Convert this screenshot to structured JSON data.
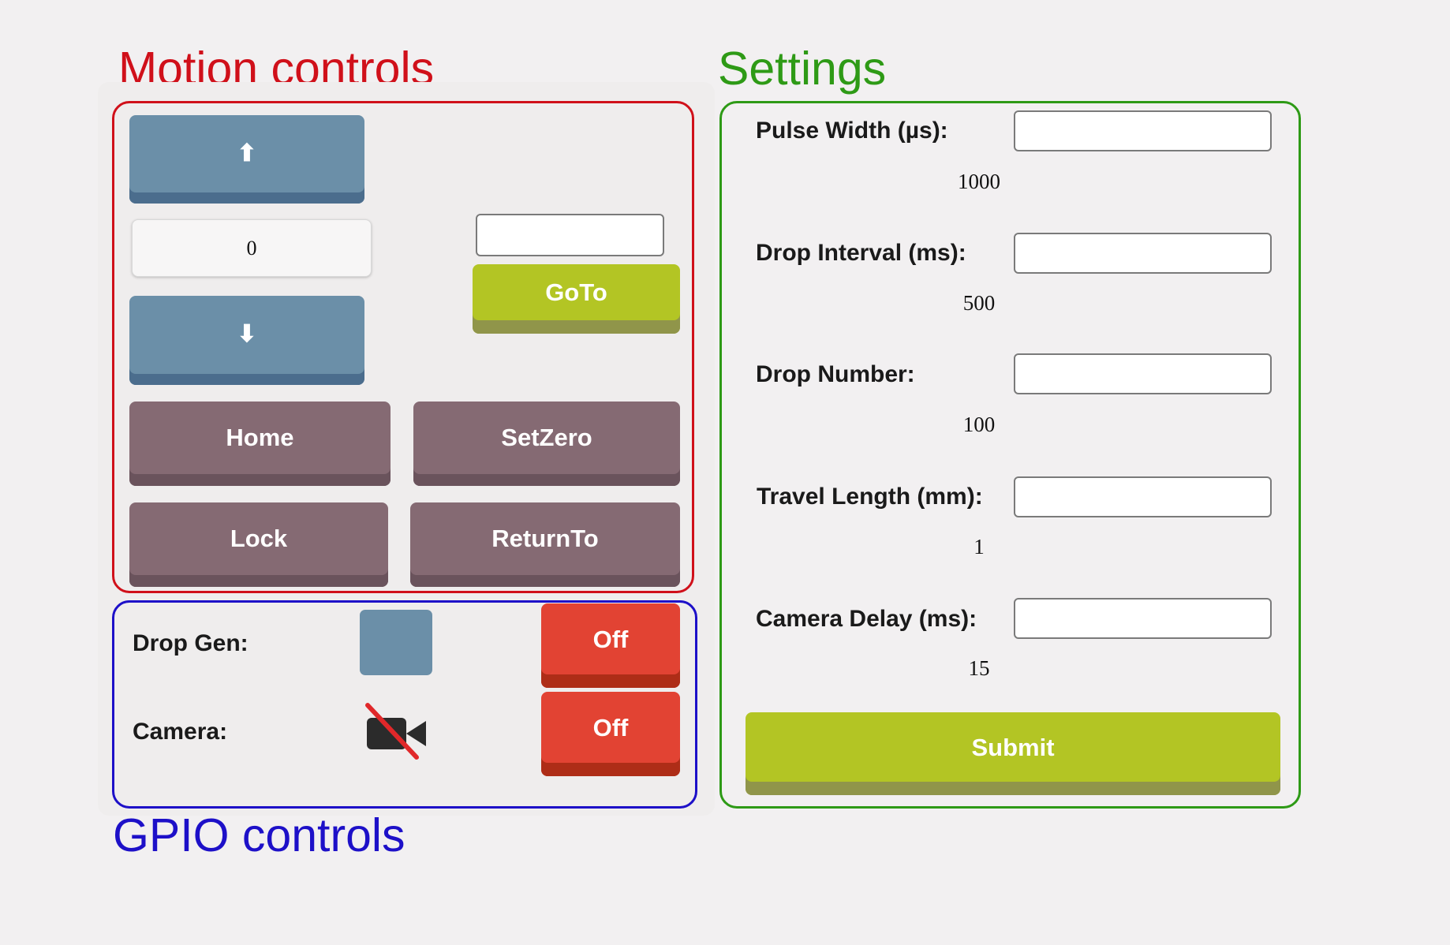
{
  "annotations": {
    "motion": "Motion controls",
    "settings": "Settings",
    "gpio": "GPIO controls"
  },
  "colors": {
    "motion_frame": "#d0101a",
    "settings_frame": "#2e9a16",
    "gpio_frame": "#1d10c8",
    "steel_button": "#6b8fa8",
    "mauve_button": "#856a73",
    "lime_button": "#b3c524",
    "red_button": "#e24333"
  },
  "motion": {
    "up_icon": "arrow-up-icon",
    "up_glyph": "⬆",
    "down_icon": "arrow-down-icon",
    "down_glyph": "⬇",
    "position": "0",
    "goto_value": "",
    "goto_label": "GoTo",
    "home_label": "Home",
    "setzero_label": "SetZero",
    "lock_label": "Lock",
    "returnto_label": "ReturnTo"
  },
  "gpio": {
    "drop_gen_label": "Drop Gen:",
    "drop_gen_button": "Off",
    "camera_label": "Camera:",
    "camera_icon": "video-camera-off-icon",
    "camera_button": "Off"
  },
  "settings": {
    "fields": [
      {
        "label": "Pulse Width (µs):",
        "value": "",
        "current": "1000"
      },
      {
        "label": "Drop Interval (ms):",
        "value": "",
        "current": "500"
      },
      {
        "label": "Drop Number:",
        "value": "",
        "current": "100"
      },
      {
        "label": "Travel Length (mm):",
        "value": "",
        "current": "1"
      },
      {
        "label": "Camera Delay (ms):",
        "value": "",
        "current": "15"
      }
    ],
    "submit_label": "Submit"
  }
}
